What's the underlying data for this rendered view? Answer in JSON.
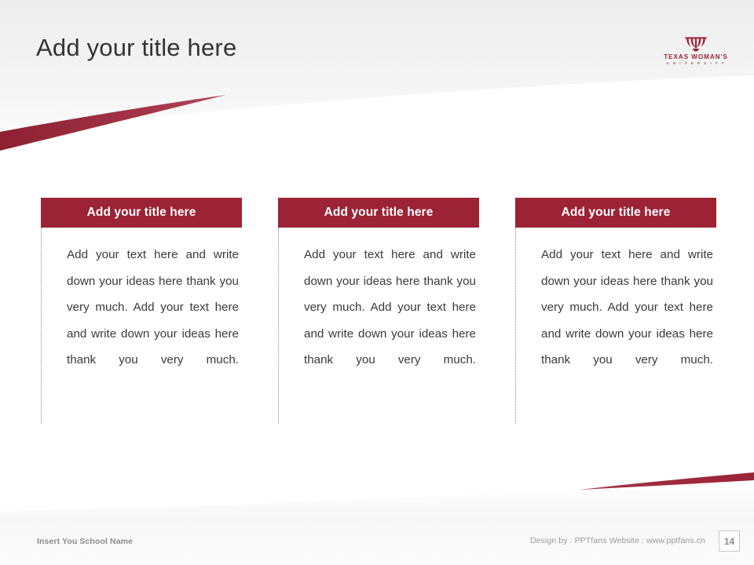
{
  "slide": {
    "title": "Add your title here"
  },
  "logo": {
    "mark_name": "twu-crest-icon",
    "name": "TEXAS WOMAN'S",
    "subtitle": "U N I V E R S I T Y"
  },
  "columns": [
    {
      "banner": "Add your title here",
      "text": "Add your text here and write down your ideas here thank you very much. Add your text here and write down your ideas here thank you very much."
    },
    {
      "banner": "Add your title here",
      "text": "Add your text here and write down your ideas here thank you very much. Add your text here and write down your ideas here thank you very much."
    },
    {
      "banner": "Add your title here",
      "text": "Add your text here and write down your ideas here thank you very much. Add your text here and write down your ideas here thank you very much."
    }
  ],
  "footer": {
    "school_name": "Insert You School Name",
    "credit": "Design by : PPTfans  Website : www.pptfans.cn",
    "slide_number": "14"
  },
  "colors": {
    "accent_maroon": "#9B2335",
    "banner_maroon": "#9B2335",
    "title_text": "#333333",
    "body_text": "#3A3A3A",
    "footer_text": "#8D8D8D",
    "header_gray": "#F2F2F2"
  }
}
